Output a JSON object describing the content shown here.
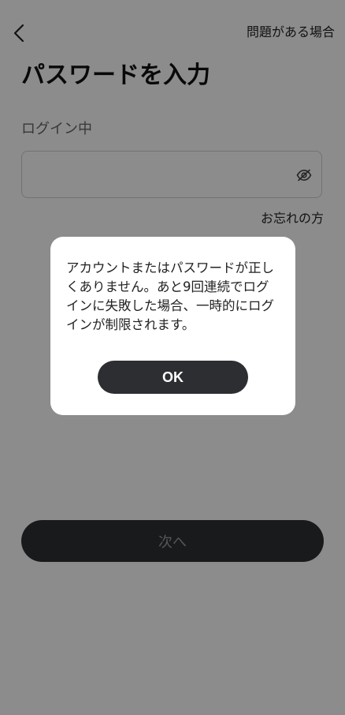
{
  "header": {
    "back_icon": "chevron-left-icon",
    "help_label": "問題がある場合"
  },
  "main": {
    "title": "パスワードを入力",
    "login_status": "ログイン中",
    "password_field": {
      "value": "",
      "placeholder": "",
      "toggle_icon": "eye-off-icon"
    },
    "forgot_label": "お忘れの方",
    "next_label": "次へ"
  },
  "dialog": {
    "message": "アカウントまたはパスワードが正しくありません。あと9回連続でログインに失敗した場合、一時的にログインが制限されます。",
    "ok_label": "OK"
  },
  "colors": {
    "overlay": "#737373",
    "button_dark": "#2d2e32",
    "dialog_bg": "#ffffff"
  }
}
